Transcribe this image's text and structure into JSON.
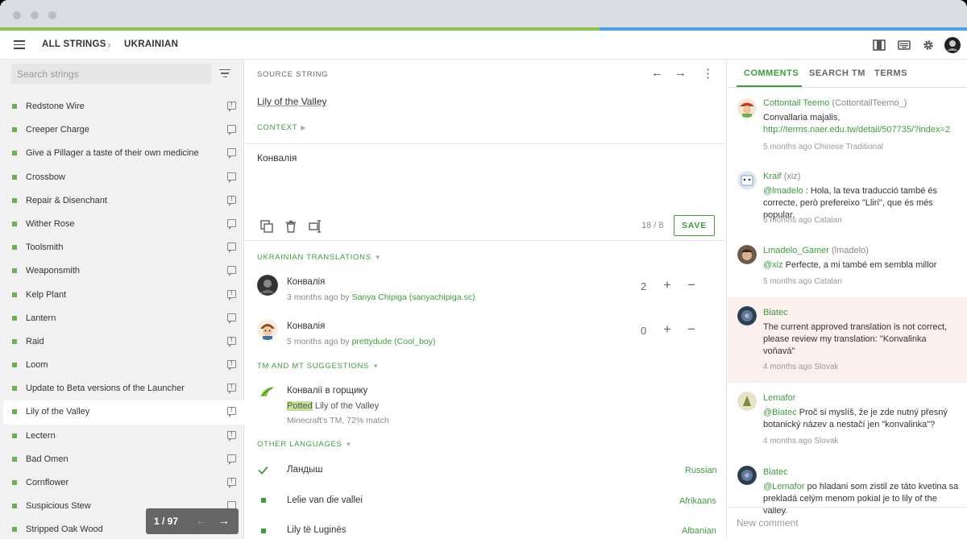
{
  "app": {
    "progress_fraction": 0.62
  },
  "header": {
    "breadcrumb_root": "ALL STRINGS",
    "breadcrumb_current": "UKRAINIAN",
    "icons": [
      "menu-icon",
      "layout-icon",
      "keyboard-icon",
      "gear-icon",
      "avatar"
    ]
  },
  "sidebar": {
    "search_placeholder": "Search strings",
    "items": [
      {
        "label": "Redstone Wire",
        "comment": "bang"
      },
      {
        "label": "Creeper Charge",
        "comment": "plain"
      },
      {
        "label": "Give a Pillager a taste of their own medicine",
        "comment": "plain"
      },
      {
        "label": "Crossbow",
        "comment": "plain"
      },
      {
        "label": "Repair & Disenchant",
        "comment": "bang"
      },
      {
        "label": "Wither Rose",
        "comment": "plain"
      },
      {
        "label": "Toolsmith",
        "comment": "plain"
      },
      {
        "label": "Weaponsmith",
        "comment": "plain"
      },
      {
        "label": "Kelp Plant",
        "comment": "bang"
      },
      {
        "label": "Lantern",
        "comment": "plain"
      },
      {
        "label": "Raid",
        "comment": "bang"
      },
      {
        "label": "Loom",
        "comment": "bang"
      },
      {
        "label": "Update to Beta versions of the Launcher",
        "comment": "bang"
      },
      {
        "label": "Lily of the Valley",
        "comment": "bang",
        "active": true
      },
      {
        "label": "Lectern",
        "comment": "bang"
      },
      {
        "label": "Bad Omen",
        "comment": "plain"
      },
      {
        "label": "Cornflower",
        "comment": "bang"
      },
      {
        "label": "Suspicious Stew",
        "comment": "plain"
      },
      {
        "label": "Stripped Oak Wood",
        "comment": "plain"
      }
    ],
    "pager": "1 / 97"
  },
  "editor": {
    "source_header": "SOURCE STRING",
    "source_text": "Lily of the Valley",
    "context_label": "CONTEXT",
    "translation_value": "Конвалія",
    "char_count": "18 / 8",
    "save_label": "SAVE",
    "translations_header": "UKRAINIAN TRANSLATIONS",
    "translations": [
      {
        "text": "Конвалія",
        "time": "3 months ago by ",
        "author": "Sanya Chipiga (sanyachipiga.sc)",
        "votes": "2"
      },
      {
        "text": "Конвалія",
        "time": "5 months ago by ",
        "author": "prettydude (Cool_boy)",
        "votes": "0"
      }
    ],
    "suggestions_header": "TM AND MT SUGGESTIONS",
    "suggestion": {
      "text": "Конвалії в горщику",
      "highlight": "Potted",
      "source_rest": " Lily of the Valley",
      "meta": "Minecraft's TM, 72% match"
    },
    "other_header": "OTHER LANGUAGES",
    "other_languages": [
      {
        "text": "Ландыш",
        "lang": "Russian",
        "mark": "check"
      },
      {
        "text": "Lelie van die vallei",
        "lang": "Afrikaans",
        "mark": "square"
      },
      {
        "text": "Lily të Luginës",
        "lang": "Albanian",
        "mark": "square"
      }
    ]
  },
  "comments_panel": {
    "tabs": [
      "COMMENTS",
      "SEARCH TM",
      "TERMS"
    ],
    "new_comment_placeholder": "New comment",
    "comments": [
      {
        "name": "Cottontail Teemo",
        "handle": "(CottontailTeemo_)",
        "body": "Convallaria majalis,",
        "link": "http://terms.naer.edu.tw/detail/507735/?index=2",
        "meta": "5 months ago  Chinese Traditional"
      },
      {
        "name": "Kraif",
        "handle": "(xiz)",
        "mention": "@lmadelo",
        "body": " : Hola, la teva traducció també és correcte, però prefereixo \"Lliri\", que és més popular.",
        "meta": "5 months ago  Catalan"
      },
      {
        "name": "Lmadelo_Gamer",
        "handle": "(lmadelo)",
        "mention": "@xiz",
        "body": " Perfecte, a mi també em sembla millor",
        "meta": "5 months ago  Catalan"
      },
      {
        "name": "Biatec",
        "handle": "",
        "body": "The current approved translation is not correct, please review my translation: \"Konvalinka voňavá\"",
        "meta": "4 months ago  Slovak",
        "flag": true
      },
      {
        "name": "Lemafor",
        "handle": "",
        "mention": "@Biatec",
        "body": " Proč si myslíš, že je zde nutný přesný botanický název a nestačí jen \"konvalinka\"?",
        "meta": "4 months ago  Slovak"
      },
      {
        "name": "Biatec",
        "handle": "",
        "mention": "@Lemafor",
        "body": " po hladani som zistil ze táto kvetina sa prekladá celým menom pokial je to lily of the valley.",
        "meta": ""
      }
    ]
  },
  "colors": {
    "accent": "#3e9b3e",
    "progress_green": "#8bc34a",
    "progress_blue": "#4aa3e8",
    "flag_bg": "#fcf0ef"
  }
}
